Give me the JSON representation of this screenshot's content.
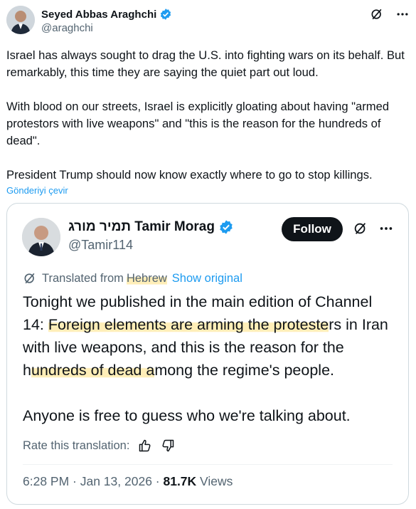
{
  "tweet": {
    "author_name": "Seyed Abbas Araghchi",
    "author_handle": "@araghchi",
    "paragraphs": [
      "Israel has always sought to drag the U.S. into fighting wars on its behalf. But remarkably, this time they are saying the quiet part out loud.",
      "With blood on our streets, Israel is explicitly gloating about having \"armed protestors with live weapons\" and \"this is the reason for the hundreds of dead\".",
      "President Trump should now know exactly where to go to stop killings."
    ],
    "translate_link": "Gönderiyi çevir",
    "icons": [
      "verified-badge-icon",
      "grok-icon",
      "more-icon"
    ]
  },
  "quoted": {
    "author_name": "תמיר מורג Tamir Morag",
    "author_handle": "@Tamir114",
    "follow_label": "Follow",
    "translated_from_prefix": "Translated from",
    "translated_language": "Hebrew",
    "show_original": "Show original",
    "text_p1_a": "Tonight we published in the main edition of Channel 14: ",
    "text_p1_hl1": "Foreign elements are arming the proteste",
    "text_p1_b": "rs in Iran with live weapons, and this is the reason for the h",
    "text_p1_hl2": "undreds of dead a",
    "text_p1_c": "mong the regime's people.",
    "text_p2": "Anyone is free to guess who we're talking about.",
    "rate_label": "Rate this translation:",
    "timestamp": "6:28 PM · Jan 13, 2026 · ",
    "views_count": "81.7K",
    "views_label": " Views",
    "icons": [
      "translate-icon",
      "thumbs-up-icon",
      "thumbs-down-icon",
      "grok-icon",
      "more-icon"
    ]
  },
  "colors": {
    "text": "#0f1419",
    "secondary": "#536471",
    "link": "#1d9bf0",
    "verified": "#1d9bf0",
    "highlight": "#ffe8a0",
    "border": "#cfd9de"
  }
}
